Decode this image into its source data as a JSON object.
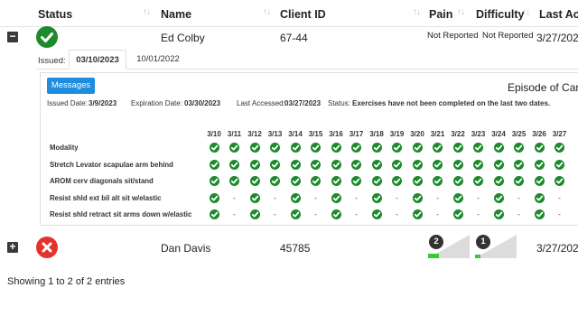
{
  "table": {
    "columns": [
      {
        "key": "status",
        "label": "Status"
      },
      {
        "key": "name",
        "label": "Name"
      },
      {
        "key": "client_id",
        "label": "Client ID"
      },
      {
        "key": "pain",
        "label": "Pain"
      },
      {
        "key": "difficulty",
        "label": "Difficulty"
      },
      {
        "key": "last_accessed",
        "label": "Last Acce"
      }
    ],
    "rows": [
      {
        "expanded": true,
        "expander": "−",
        "status": "ok",
        "status_icon": "check-circle-icon",
        "name": "Ed Colby",
        "client_id": "67-44",
        "pain": "Not Reported",
        "difficulty": "Not Reported",
        "last_accessed": "3/27/202"
      },
      {
        "expanded": false,
        "expander": "+",
        "status": "error",
        "status_icon": "x-circle-icon",
        "name": "Dan Davis",
        "client_id": "45785",
        "pain_value": 2,
        "difficulty_value": 1,
        "last_accessed": "3/27/202"
      }
    ]
  },
  "issued": {
    "label": "Issued:",
    "tabs": [
      {
        "label": "03/10/2023",
        "active": true
      },
      {
        "label": "10/01/2022",
        "active": false
      }
    ]
  },
  "episode": {
    "messages_button": "Messages",
    "title": "Episode of Care",
    "issued_date_label": "Issued Date:",
    "issued_date": "3/9/2023",
    "expiration_label": "Expiration Date:",
    "expiration_date": "03/30/2023",
    "last_accessed_label": "Last Accessed:",
    "last_accessed": "03/27/2023",
    "status_label": "Status:",
    "status_text": "Exercises have not been completed on the last two dates.",
    "dates": [
      "3/10",
      "3/11",
      "3/12",
      "3/13",
      "3/14",
      "3/15",
      "3/16",
      "3/17",
      "3/18",
      "3/19",
      "3/20",
      "3/21",
      "3/22",
      "3/23",
      "3/24",
      "3/25",
      "3/26",
      "3/27"
    ],
    "exercises": [
      {
        "name": "Modality",
        "marks": "cccccccccccccccccc"
      },
      {
        "name": "Stretch Levator scapulae arm behind",
        "marks": "cccccccccccccccccc"
      },
      {
        "name": "AROM cerv diagonals sit/stand",
        "marks": "cccccccccccccccccc"
      },
      {
        "name": "Resist shld ext bil alt sit w/elastic",
        "marks": "c-c-c-c-c-c-c-c-c-"
      },
      {
        "name": "Resist shld retract sit arms down w/elastic",
        "marks": "c-c-c-c-c-c-c-c-c-"
      }
    ],
    "colors": {
      "done": "#1d8a2c",
      "accent": "#1f8ce0"
    }
  },
  "footer": {
    "entries_text": "Showing 1 to 2 of 2 entries"
  }
}
